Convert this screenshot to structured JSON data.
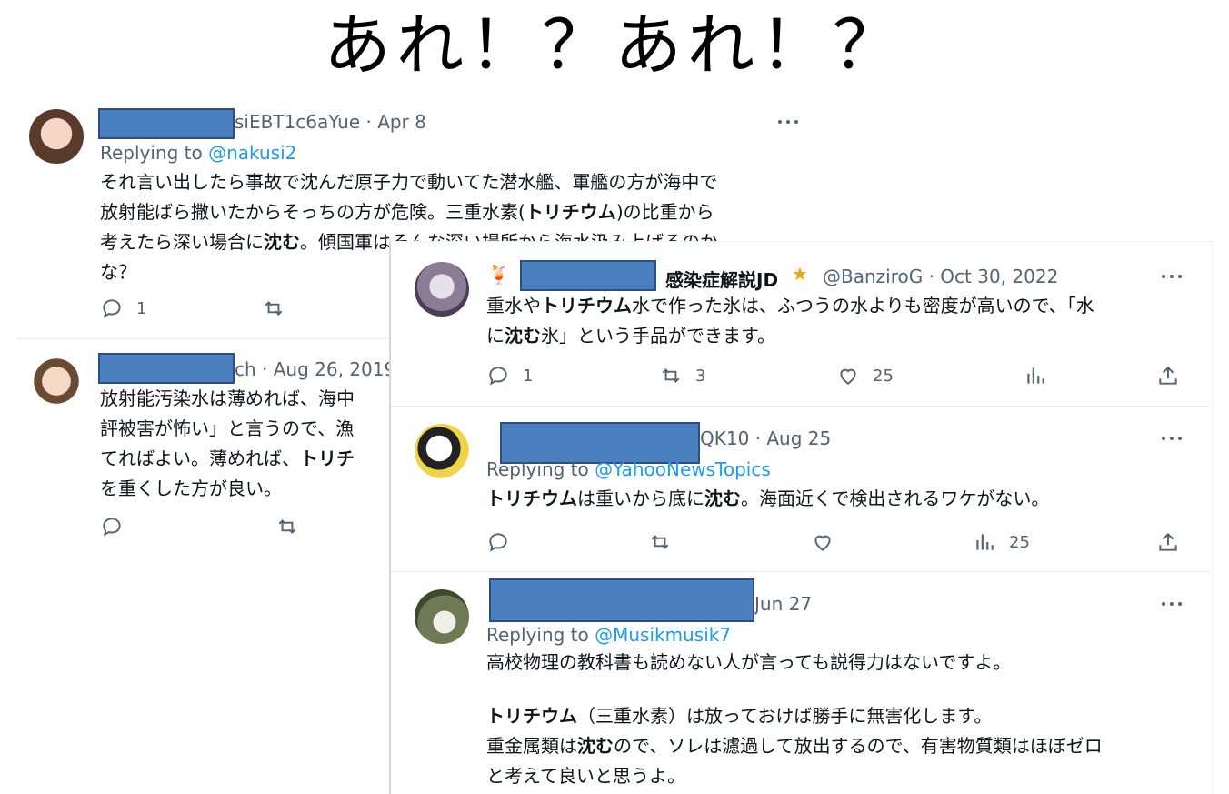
{
  "headline": "あれ！？あれ！？",
  "tweets": [
    {
      "handle": "siEBT1c6aYue · Apr 8",
      "reply_prefix": "Replying to ",
      "reply_to": "@nakusi2",
      "lines": [
        "それ言い出したら事故で沈んだ原子力で動いてた潜水艦、軍艦の方が海中で",
        "放射能ばら撒いたからそっちの方が危険。三重水素(",
        "トリチウム",
        ")の比重から",
        "考えたら深い場合に",
        "沈む",
        "。傾国軍はそんな深い場所から海水汲み上げるのか",
        "な？"
      ],
      "reply_count": "1"
    },
    {
      "handle": "ch · Aug 26, 2019",
      "lines": [
        "放射能汚染水は薄めれば、海中",
        "評被害が怖い」と言うので、漁",
        "てればよい。薄めれば、",
        "トリチ",
        "を重くした方が良い。"
      ]
    },
    {
      "name": "感染症解説JD",
      "handle": "@BanziroG · Oct 30, 2022",
      "lines": [
        "重水や",
        "トリチウム",
        "水で作った氷は、ふつうの水よりも密度が高いので、「水",
        "に",
        "沈む",
        "氷」という手品ができます。"
      ],
      "reply_count": "1",
      "retweet_count": "3",
      "like_count": "25"
    },
    {
      "handle": "QK10 · Aug 25",
      "reply_prefix": "Replying to ",
      "reply_to": "@YahooNewsTopics",
      "lines": [
        "トリチウム",
        "は重いから底に",
        "沈む",
        "。海面近くで検出されるワケがない。"
      ],
      "views_count": "25"
    },
    {
      "handle": "Jun 27",
      "reply_prefix": "Replying to ",
      "reply_to": "@Musikmusik7",
      "lines": [
        "高校物理の教科書も読めない人が言っても説得力はないですよ。",
        "トリチウム",
        "（三重水素）は放っておけば勝手に無害化します。",
        "重金属類は",
        "沈む",
        "ので、ソレは濾過して放出するので、有害物質類はほぼゼロ",
        "と考えて良いと思うよ。"
      ]
    }
  ],
  "colors": {
    "link": "#1d9bf0",
    "muted": "#536471",
    "redaction": "#4a7fc0"
  }
}
